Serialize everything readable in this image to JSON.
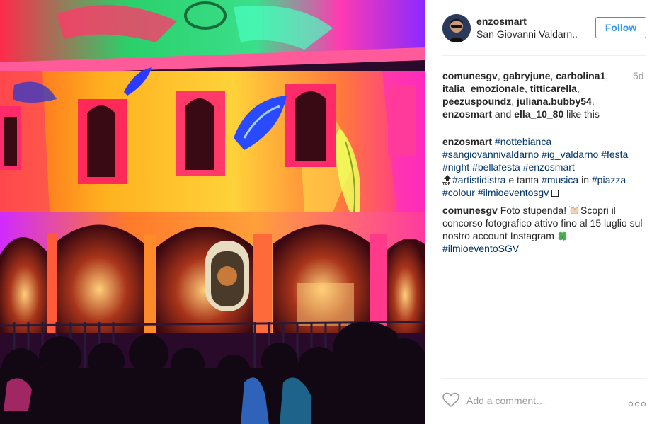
{
  "post": {
    "username": "enzosmart",
    "location": "San Giovanni Valdarn..",
    "follow_label": "Follow",
    "age": "5d",
    "likes": {
      "names": [
        "comunesgv",
        "gabryjune",
        "carbolina1",
        "italia_emozionale",
        "titticarella",
        "peezuspoundz",
        "juliana.bubby54",
        "enzosmart",
        "ella_10_80"
      ],
      "sep": ", ",
      "and": " and ",
      "suffix": " like this"
    },
    "caption": {
      "author": "enzosmart",
      "tags_line1": [
        "#nottebianca"
      ],
      "tags_line2": [
        "#sangiovannivaldarno",
        "#ig_valdarno",
        "#festa"
      ],
      "tags_line3": [
        "#night",
        "#bellafesta",
        "#enzosmart"
      ],
      "tag_artisti": "#artistidistra",
      "text_e_tanta": " e tanta ",
      "tag_musica": "#musica",
      "text_in": " in ",
      "tag_piazza": "#piazza",
      "tags_line5": [
        "#colour",
        "#ilmioeventosgv"
      ]
    },
    "comment": {
      "author": "comunesgv",
      "text1": "Foto stupenda! ",
      "text2": "Scopri il concorso fotografico attivo fino al 15 luglio sul nostro account Instagram ",
      "tag": "#ilmioeventoSGV"
    },
    "add_comment_placeholder": "Add a comment…"
  },
  "icons": {
    "heart": "heart-outline-icon",
    "more": "more-options-icon",
    "top": "top-arrow-emoji",
    "clap": "clapping-hands-emoji",
    "clover": "four-leaf-clover-emoji"
  },
  "colors": {
    "follow_blue": "#3897f0",
    "hashtag": "#003569",
    "muted": "#999999"
  }
}
